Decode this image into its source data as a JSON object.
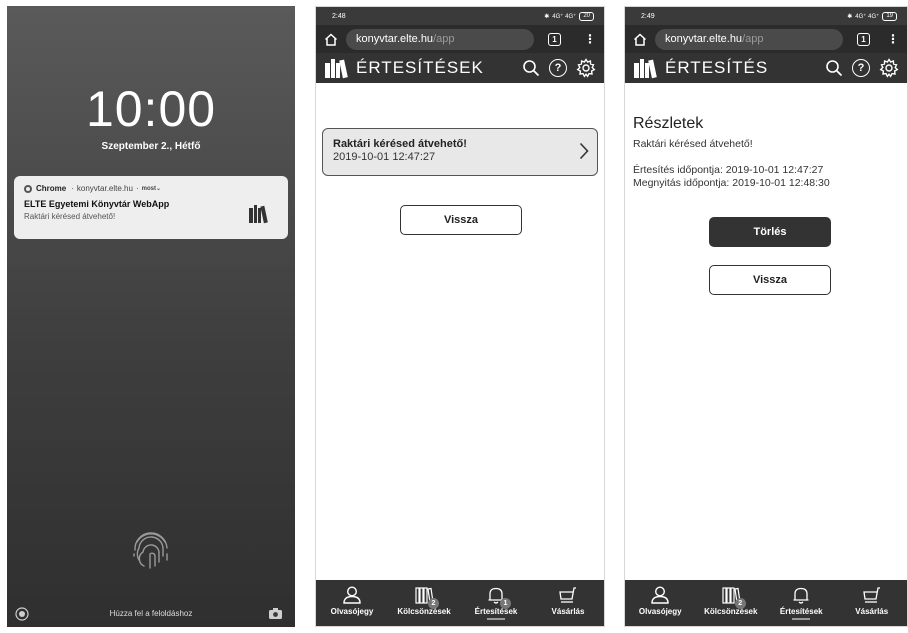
{
  "lock": {
    "time": "10:00",
    "date": "Szeptember 2., Hétfő",
    "notification": {
      "app": "Chrome",
      "site": "konyvtar.elte.hu",
      "when": "most",
      "title": "ELTE Egyetemi Könyvtár WebApp",
      "body": "Raktári kérésed átvehető!"
    },
    "hint": "Húzza fel a feloldáshoz"
  },
  "list_screen": {
    "status_time": "2:48",
    "battery": "20",
    "url_host": "konyvtar.elte.hu",
    "url_path": "/app",
    "tab_count": "1",
    "header_title": "ÉRTESÍTÉSEK",
    "item": {
      "title": "Raktári kérésed átvehető!",
      "date": "2019-10-01 12:47:27"
    },
    "back_button": "Vissza",
    "nav": [
      {
        "label": "Olvasójegy",
        "icon": "user-icon",
        "badge": ""
      },
      {
        "label": "Kölcsönzések",
        "icon": "books-icon",
        "badge": "2"
      },
      {
        "label": "Értesítések",
        "icon": "bell-icon",
        "badge": "1"
      },
      {
        "label": "Vásárlás",
        "icon": "cart-icon",
        "badge": ""
      }
    ]
  },
  "detail_screen": {
    "status_time": "2:49",
    "battery": "19",
    "url_host": "konyvtar.elte.hu",
    "url_path": "/app",
    "tab_count": "1",
    "header_title": "ÉRTESÍTÉS",
    "heading": "Részletek",
    "message": "Raktári kérésed átvehető!",
    "notified_line": "Értesítés időpontja: 2019-10-01 12:47:27",
    "opened_line": "Megnyitás időpontja: 2019-10-01 12:48:30",
    "delete_button": "Törlés",
    "back_button": "Vissza",
    "nav": [
      {
        "label": "Olvasójegy",
        "icon": "user-icon",
        "badge": ""
      },
      {
        "label": "Kölcsönzések",
        "icon": "books-icon",
        "badge": "2"
      },
      {
        "label": "Értesítések",
        "icon": "bell-icon",
        "badge": ""
      },
      {
        "label": "Vásárlás",
        "icon": "cart-icon",
        "badge": ""
      }
    ]
  },
  "status_bar": {
    "network": "4G⁺ 4G⁺"
  }
}
